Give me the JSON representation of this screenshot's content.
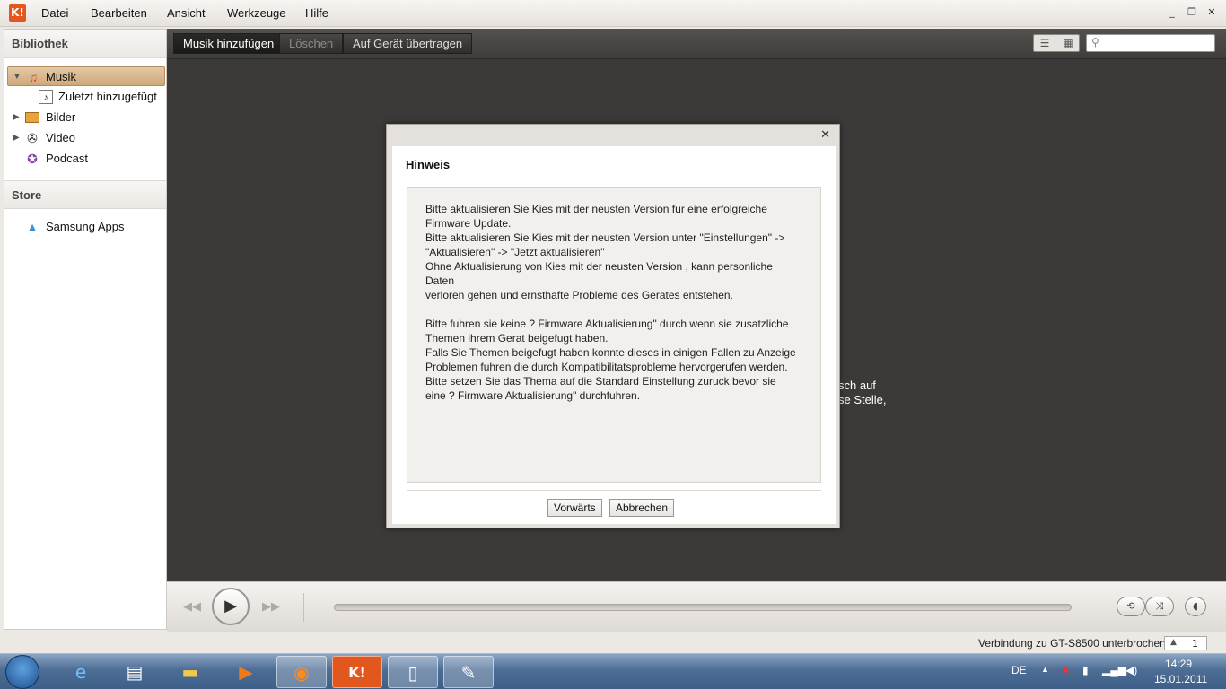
{
  "menubar": {
    "logo": "K!",
    "items": [
      "Datei",
      "Bearbeiten",
      "Ansicht",
      "Werkzeuge",
      "Hilfe"
    ],
    "minimize": "_",
    "restore": "❐",
    "close": "✕"
  },
  "sidebar": {
    "library_header": "Bibliothek",
    "items": [
      {
        "label": "Musik",
        "icon": "music-note-icon",
        "selected": true
      },
      {
        "label": "Zuletzt hinzugefügt",
        "icon": "playlist-icon"
      },
      {
        "label": "Bilder",
        "icon": "pictures-icon"
      },
      {
        "label": "Video",
        "icon": "film-reel-icon"
      },
      {
        "label": "Podcast",
        "icon": "podcast-icon"
      }
    ],
    "store_header": "Store",
    "store_items": [
      {
        "label": "Samsung Apps",
        "icon": "samsung-apps-icon"
      }
    ]
  },
  "toolbar": {
    "add_music": "Musik hinzufügen",
    "delete": "Löschen",
    "transfer": "Auf Gerät übertragen",
    "search_placeholder": ""
  },
  "background": {
    "line1": "sch auf",
    "line2": "se Stelle,"
  },
  "dialog": {
    "title": "Hinweis",
    "message": "Bitte aktualisieren Sie Kies mit der neusten Version fur eine erfolgreiche\nFirmware Update.\nBitte aktualisieren Sie Kies mit der neusten Version unter   \"Einstellungen\" ->\n\"Aktualisieren\" -> \"Jetzt aktualisieren\"\nOhne Aktualisierung von Kies mit der neusten Version , kann personliche Daten\nverloren gehen und ernsthafte Probleme des Gerates entstehen.\n\nBitte fuhren sie keine  ?  Firmware Aktualisierung\" durch wenn sie zusatzliche\nThemen ihrem Gerat beigefugt haben.\nFalls Sie Themen beigefugt haben konnte dieses in einigen Fallen zu Anzeige\nProblemen fuhren die durch Kompatibilitatsprobleme hervorgerufen werden.\nBitte setzen Sie das Thema auf die Standard Einstellung zuruck bevor sie\neine  ?  Firmware Aktualisierung\" durchfuhren.",
    "forward": "Vorwärts",
    "cancel": "Abbrechen",
    "close": "✕"
  },
  "status": {
    "text": "Verbindung zu GT-S8500 unterbrochen.",
    "page": "1"
  },
  "tray": {
    "lang": "DE",
    "time": "14:29",
    "date": "15.01.2011"
  }
}
